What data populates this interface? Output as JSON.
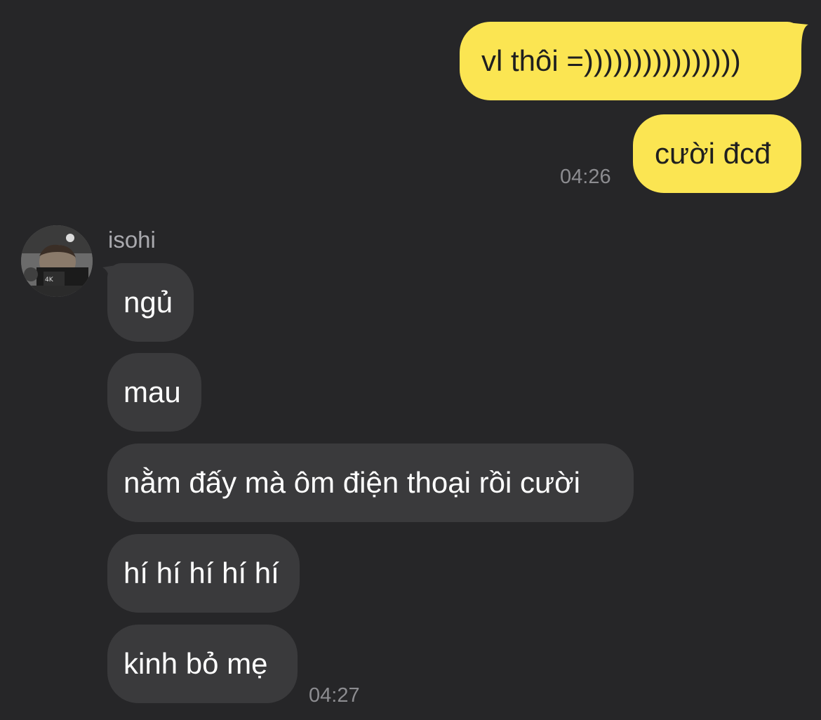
{
  "colors": {
    "background": "#262628",
    "outgoing_bubble": "#FBE552",
    "incoming_bubble": "#3A3A3C",
    "timestamp": "#8C8C90"
  },
  "outgoing": {
    "messages": [
      {
        "text": "vl thôi =))))))))))))))))"
      },
      {
        "text": "cười đcđ"
      }
    ],
    "time": "04:26"
  },
  "incoming": {
    "sender": "isohi",
    "avatar_icon": "user-avatar-photo",
    "avatar_caption": "4K",
    "messages": [
      {
        "text": "ngủ"
      },
      {
        "text": "mau"
      },
      {
        "text": "nằm đấy mà ôm điện thoại rồi cười"
      },
      {
        "text": "hí hí hí hí hí"
      },
      {
        "text": "kinh bỏ mẹ"
      }
    ],
    "time": "04:27"
  }
}
